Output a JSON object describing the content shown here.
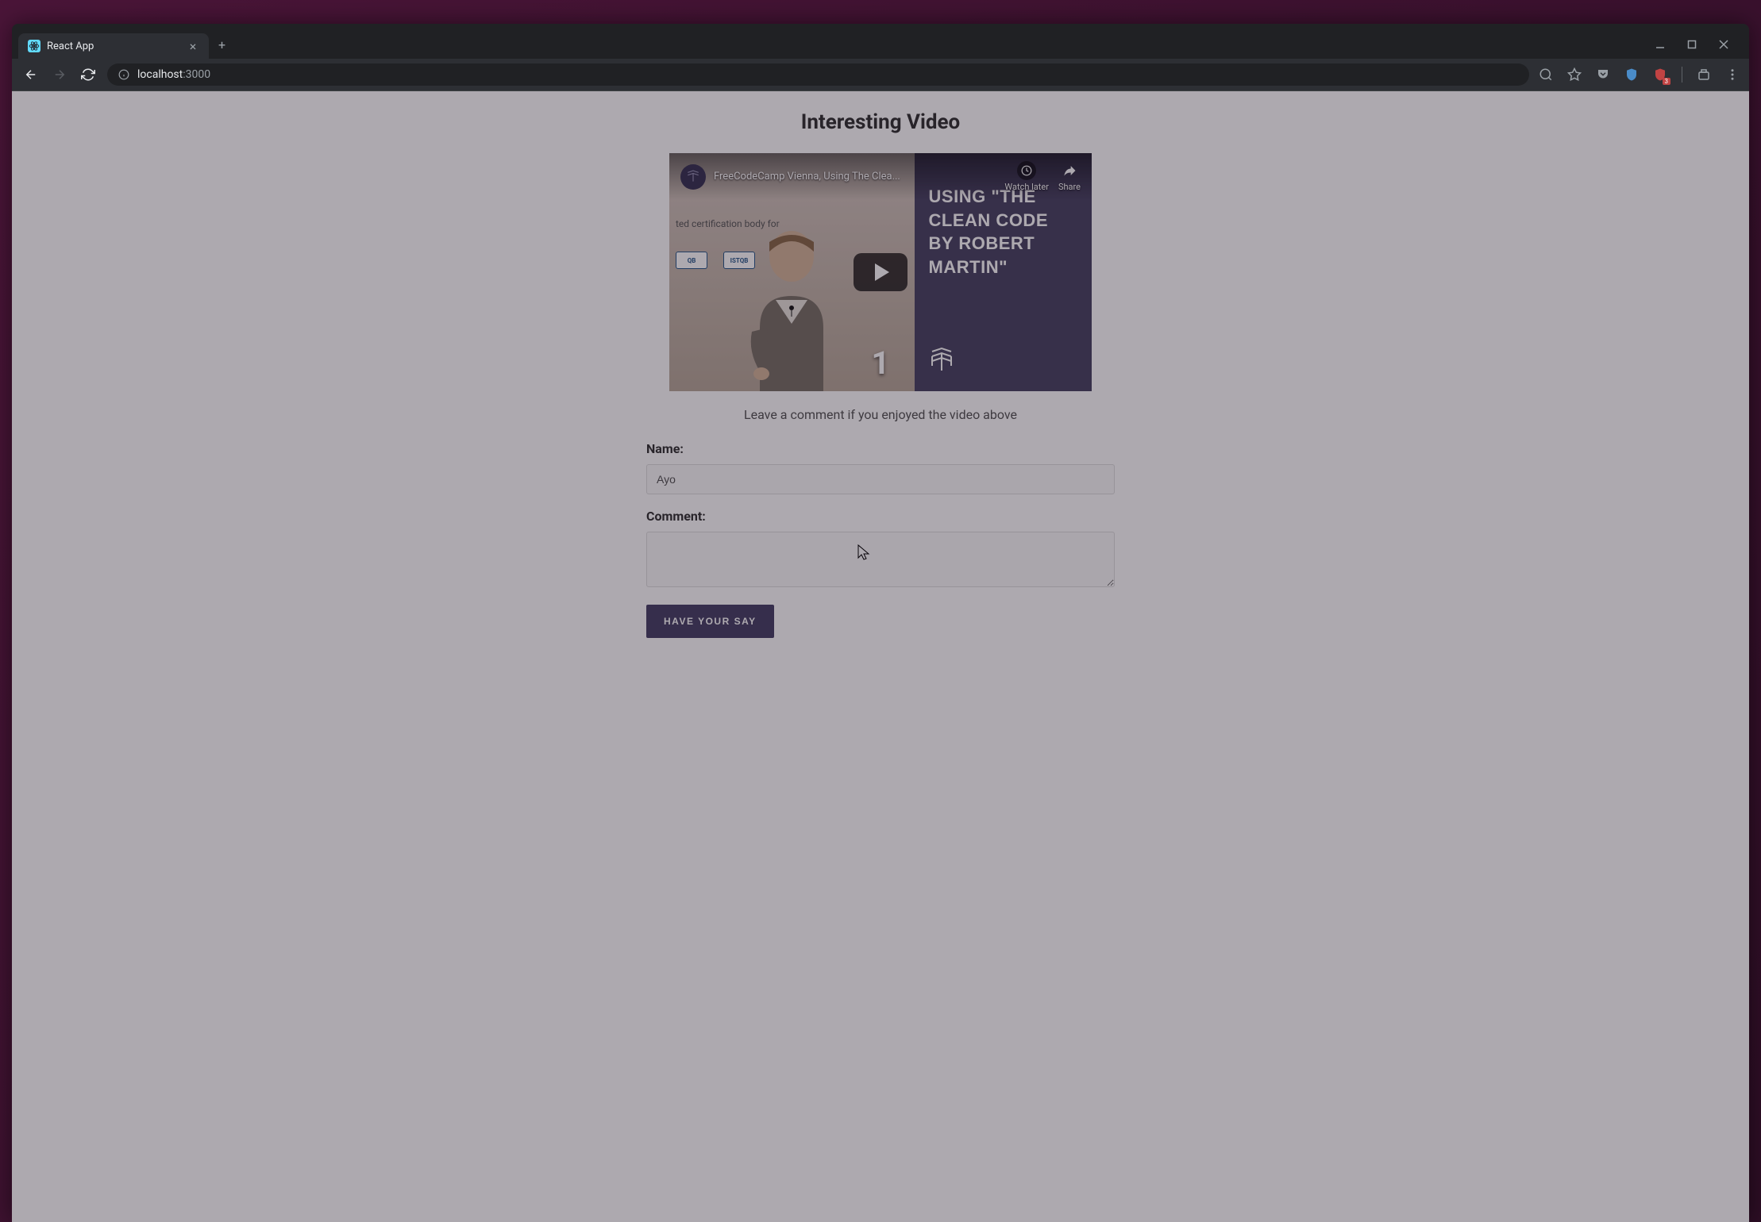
{
  "browser": {
    "tab_title": "React App",
    "url_host": "localhost",
    "url_port": ":3000",
    "ublock_badge": "3"
  },
  "page": {
    "title": "Interesting Video",
    "subtitle": "Leave a comment if you enjoyed the video above"
  },
  "video": {
    "title": "FreeCodeCamp Vienna, Using The Clea...",
    "overlay_title": "USING \"THE CLEAN CODE BY ROBERT MARTIN\"",
    "watch_later_label": "Watch later",
    "share_label": "Share",
    "counter": "1",
    "bg_text": "ted certification body for",
    "bg_logo1": "QB",
    "bg_logo2": "ISTQB"
  },
  "form": {
    "name_label": "Name:",
    "name_value": "Ayo",
    "comment_label": "Comment:",
    "comment_value": "",
    "submit_label": "HAVE YOUR SAY"
  }
}
